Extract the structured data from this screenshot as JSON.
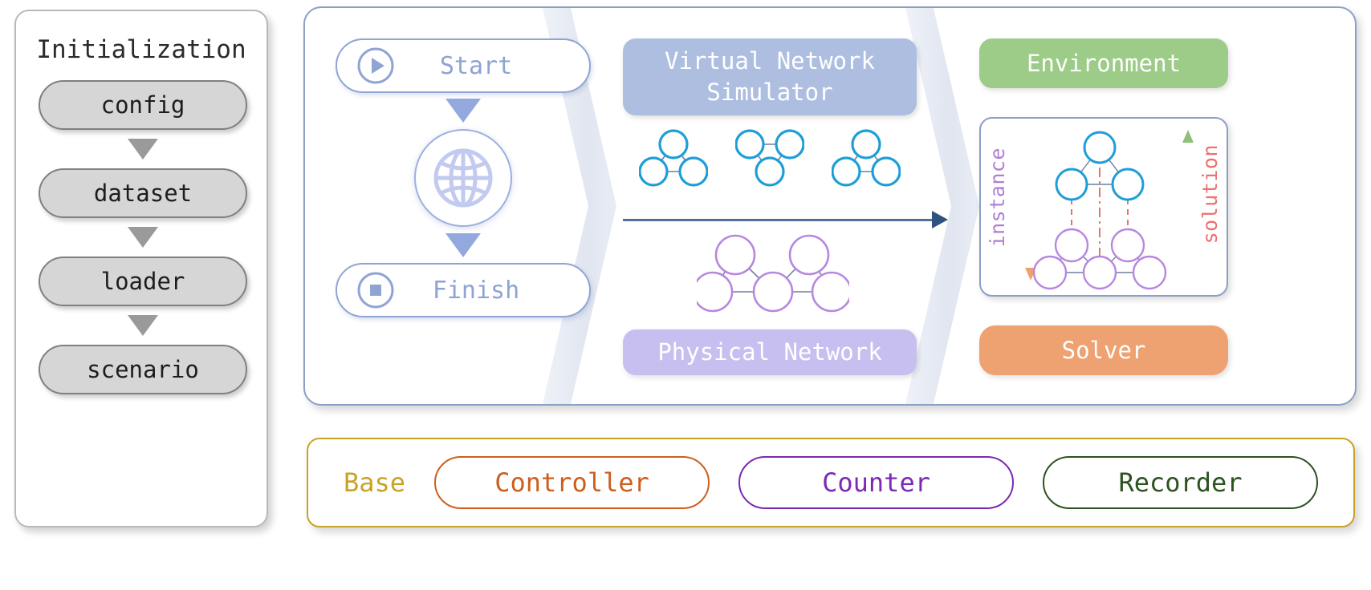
{
  "initialization": {
    "title": "Initialization",
    "steps": [
      {
        "label": "config"
      },
      {
        "label": "dataset"
      },
      {
        "label": "loader"
      },
      {
        "label": "scenario"
      }
    ],
    "arrow_icon": "triangle-down-icon"
  },
  "flow": {
    "start": {
      "label": "Start",
      "icon": "play-circle-icon"
    },
    "finish": {
      "label": "Finish",
      "icon": "stop-circle-icon"
    },
    "middle": {
      "icon": "globe-icon"
    },
    "arrow_icon": "triangle-down-icon"
  },
  "simulator": {
    "header": "Virtual Network\nSimulator",
    "header_line1": "Virtual Network",
    "header_line2": "Simulator",
    "footer": "Physical Network",
    "flow_arrow_icon": "arrow-right-icon"
  },
  "environment": {
    "header": "Environment",
    "solver": "Solver",
    "instance_label": "instance",
    "solution_label": "solution",
    "instance_arrow_icon": "arrow-down-icon",
    "solution_arrow_icon": "arrow-up-icon"
  },
  "base_bar": {
    "base_label": "Base",
    "items": [
      {
        "label": "Controller"
      },
      {
        "label": "Counter"
      },
      {
        "label": "Recorder"
      }
    ]
  },
  "colors": {
    "init_pill_fill": "#d6d6d6",
    "init_pill_border": "#808080",
    "init_arrow": "#9a9a9a",
    "panel_border": "#8c9fc6",
    "flow_blue": "#90a4d4",
    "flow_text": "#8fa3d3",
    "vns_header": "#adbee0",
    "physical_header": "#c6bff0",
    "environment_header": "#9ccc87",
    "solver_header": "#efa271",
    "virtual_node": "#1d9ed8",
    "physical_node": "#b787e0",
    "edge": "#6f7f9e",
    "mapping_edge": "#d9534f",
    "instance_text": "#b07fd6",
    "solution_text": "#ef6f6f",
    "base_border": "#c9a227",
    "base_text": "#c9a227",
    "controller": "#cc5f1e",
    "counter": "#7a2ab5",
    "recorder": "#2d5321",
    "arrow_line": "#4f6f9c",
    "divider": "#4f7294",
    "chevron": "#dfe4ef"
  },
  "chart_data": {
    "type": "diagram",
    "virtual_networks": [
      {
        "nodes": 3,
        "edges": 3
      },
      {
        "nodes": 3,
        "edges": 3
      },
      {
        "nodes": 3,
        "edges": 3
      }
    ],
    "physical_network": {
      "nodes": 5,
      "edges": 6
    },
    "embedding": {
      "virtual_nodes": 3,
      "physical_nodes": 5,
      "mapping_links": 3
    }
  }
}
